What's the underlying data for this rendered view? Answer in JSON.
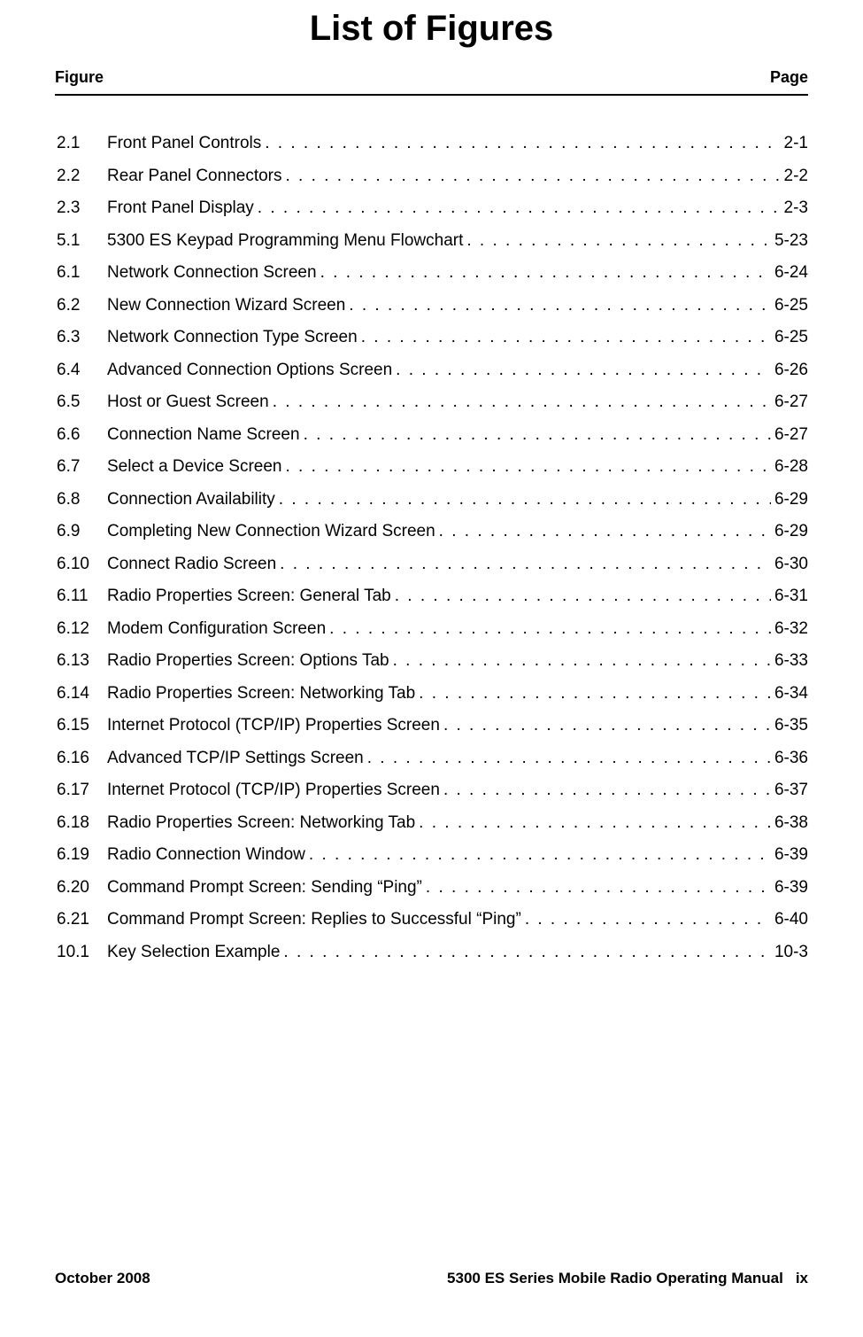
{
  "title": "List of Figures",
  "header": {
    "left": "Figure",
    "right": "Page"
  },
  "entries": [
    {
      "num": "2.1",
      "title": "Front Panel Controls",
      "page": "2-1"
    },
    {
      "num": "2.2",
      "title": "Rear Panel Connectors",
      "page": "2-2"
    },
    {
      "num": "2.3",
      "title": "Front Panel Display",
      "page": "2-3"
    },
    {
      "num": "5.1",
      "title": "5300 ES Keypad Programming Menu Flowchart",
      "page": "5-23"
    },
    {
      "num": "6.1",
      "title": "Network Connection Screen",
      "page": "6-24"
    },
    {
      "num": "6.2",
      "title": "New Connection Wizard Screen",
      "page": "6-25"
    },
    {
      "num": "6.3",
      "title": "Network Connection Type Screen",
      "page": "6-25"
    },
    {
      "num": "6.4",
      "title": "Advanced Connection Options Screen",
      "page": "6-26"
    },
    {
      "num": "6.5",
      "title": "Host or Guest Screen",
      "page": "6-27"
    },
    {
      "num": "6.6",
      "title": "Connection Name Screen",
      "page": "6-27"
    },
    {
      "num": "6.7",
      "title": "Select a Device Screen",
      "page": "6-28"
    },
    {
      "num": "6.8",
      "title": "Connection Availability",
      "page": "6-29"
    },
    {
      "num": "6.9",
      "title": "Completing New Connection Wizard Screen",
      "page": "6-29"
    },
    {
      "num": "6.10",
      "title": "Connect Radio Screen",
      "page": "6-30"
    },
    {
      "num": "6.11",
      "title": "Radio Properties Screen: General Tab",
      "page": "6-31"
    },
    {
      "num": "6.12",
      "title": "Modem Configuration Screen",
      "page": "6-32"
    },
    {
      "num": "6.13",
      "title": "Radio Properties Screen: Options Tab",
      "page": "6-33"
    },
    {
      "num": "6.14",
      "title": "Radio Properties Screen: Networking Tab",
      "page": "6-34"
    },
    {
      "num": "6.15",
      "title": "Internet Protocol (TCP/IP) Properties Screen",
      "page": "6-35"
    },
    {
      "num": "6.16",
      "title": "Advanced TCP/IP Settings Screen",
      "page": "6-36"
    },
    {
      "num": "6.17",
      "title": "Internet Protocol (TCP/IP) Properties Screen",
      "page": "6-37"
    },
    {
      "num": "6.18",
      "title": "Radio Properties Screen: Networking Tab",
      "page": "6-38"
    },
    {
      "num": "6.19",
      "title": "Radio Connection Window",
      "page": "6-39"
    },
    {
      "num": "6.20",
      "title": "Command Prompt Screen: Sending “Ping”",
      "page": "6-39"
    },
    {
      "num": "6.21",
      "title": "Command Prompt Screen: Replies to Successful “Ping”",
      "page": "6-40"
    },
    {
      "num": "10.1",
      "title": "Key Selection Example",
      "page": "10-3"
    }
  ],
  "footer": {
    "left": "October 2008",
    "manual": "5300 ES Series Mobile Radio Operating Manual",
    "page_num": "ix"
  }
}
